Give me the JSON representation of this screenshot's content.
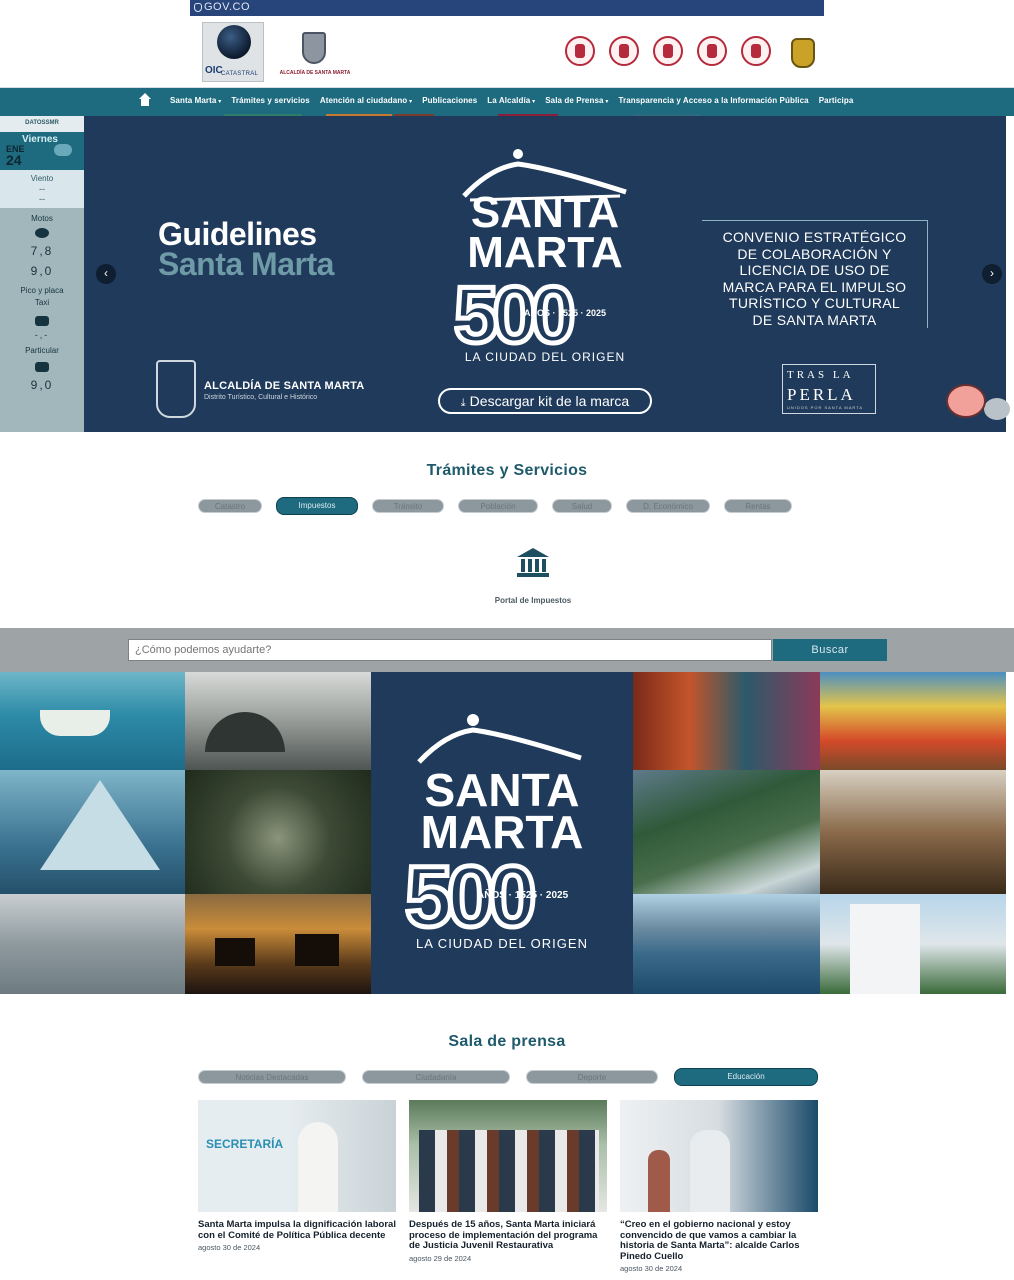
{
  "gov_bar": {
    "label": "GOV.CO"
  },
  "header": {
    "logo_oic": {
      "title": "OIC",
      "subtitle": "CATASTRAL"
    },
    "logo_alcaldia": {
      "caption": "ALCALDÍA DE SANTA MARTA"
    },
    "icon_links": [
      "accessibility-icon",
      "community-icon",
      "mail-icon",
      "transparency-icon",
      "children-icon",
      "colombia-crest-icon"
    ]
  },
  "nav": {
    "items": [
      {
        "label": "Santa Marta",
        "caret": true
      },
      {
        "label": "Trámites y servicios",
        "caret": false
      },
      {
        "label": "Atención al ciudadano",
        "caret": true
      },
      {
        "label": "Publicaciones",
        "caret": false
      },
      {
        "label": "La Alcaldía",
        "caret": true
      },
      {
        "label": "Sala de Prensa",
        "caret": true
      },
      {
        "label": "Transparencia y Acceso a la Información Pública",
        "caret": false
      },
      {
        "label": "Participa",
        "caret": false
      }
    ],
    "underline_colors": [
      "#2d7d6a",
      "#c9782f",
      "#7a3b2b",
      "#8b1f3a",
      "#2d6a7d"
    ]
  },
  "weather": {
    "brand": "DATOSSMR",
    "weekday": "Viernes",
    "month": "ENE",
    "day": "24",
    "wind_label": "Viento",
    "wind_value1": "--",
    "wind_value2": "--",
    "motos_label": "Motos",
    "motos_value1": "7,8",
    "motos_value2": "9,0",
    "pico_label": "Pico y placa",
    "taxi_label": "Taxi",
    "taxi_value": "-,-",
    "particular_label": "Particular",
    "particular_value": "9,0"
  },
  "hero": {
    "guidelines_1": "Guidelines",
    "guidelines_2": "Santa Marta",
    "logo_line1": "SANTA",
    "logo_line2": "MARTA",
    "logo_years": "AÑOS · 1525 · 2025",
    "logo_origin": "LA CIUDAD DEL ORIGEN",
    "convenio": [
      "CONVENIO ESTRATÉGICO",
      "DE COLABORACIÓN Y",
      "LICENCIA DE USO DE",
      "MARCA PARA EL IMPULSO",
      "TURÍSTICO Y CULTURAL",
      "DE SANTA MARTA"
    ],
    "alc_title": "ALCALDÍA DE SANTA MARTA",
    "alc_subtitle": "Distrito Turístico, Cultural e Histórico",
    "download_label": "Descargar kit de la marca",
    "perla_line1": "TRAS LA",
    "perla_line2": "PERLA",
    "perla_line3": "UNIDOS POR SANTA MARTA"
  },
  "tramites": {
    "title": "Trámites y Servicios",
    "tabs": [
      "Catastro",
      "Impuestos",
      "Tránsito",
      "Población",
      "Salud",
      "D. Económico",
      "Rentas"
    ],
    "active_tab": "Impuestos",
    "portal_label": "Portal de Impuestos"
  },
  "search": {
    "placeholder": "¿Cómo podemos ayudarte?",
    "button": "Buscar"
  },
  "collage": {
    "logo_line1": "SANTA",
    "logo_line2": "MARTA",
    "logo_years": "AÑOS · 1525 · 2025",
    "logo_origin": "LA CIUDAD DEL ORIGEN"
  },
  "prensa": {
    "title": "Sala de prensa",
    "tabs": [
      "Noticias Destacadas",
      "Ciudadanía",
      "Deporte",
      "Educación"
    ],
    "active_tab": "Educación",
    "cards": [
      {
        "title": "Santa Marta impulsa la dignificación laboral con el Comité de Política Pública decente",
        "date": "agosto 30 de 2024"
      },
      {
        "title": "Después de 15 años, Santa Marta iniciará proceso de implementación del programa de Justicia Juvenil Restaurativa",
        "date": "agosto 29 de 2024"
      },
      {
        "title": "“Creo en el gobierno nacional y estoy convencido de que vamos a cambiar la historia de Santa Marta”: alcalde Carlos Pinedo Cuello",
        "date": "agosto 30 de 2024"
      }
    ]
  }
}
